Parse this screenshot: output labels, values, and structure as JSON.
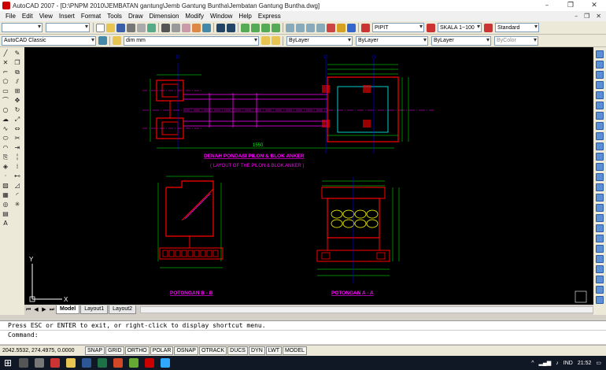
{
  "window": {
    "title": "AutoCAD 2007 - [D:\\PNPM 2010\\JEMBATAN gantung\\Jemb Gantung Buntha\\Jembatan Gantung Buntha.dwg]",
    "minimize": "–",
    "maximize": "❐",
    "close": "✕"
  },
  "menu": [
    "File",
    "Edit",
    "View",
    "Insert",
    "Format",
    "Tools",
    "Draw",
    "Dimension",
    "Modify",
    "Window",
    "Help",
    "Express"
  ],
  "toolbar": {
    "text_style": "PIPIT",
    "dim_style": "SKALA 1~100",
    "table_style": "Standard",
    "workspace": "AutoCAD Classic",
    "layer": "dim mm",
    "color": "ByLayer",
    "linetype": "ByLayer",
    "lineweight": "ByLayer",
    "plotstyle": "ByColor"
  },
  "tabs": [
    "Model",
    "Layout1",
    "Layout2"
  ],
  "command": {
    "history": "Press ESC or ENTER to exit, or right-click to display shortcut menu.",
    "prompt": "Command:"
  },
  "status": {
    "coords": "2042.5532, 274.4975, 0.0000",
    "buttons": [
      "SNAP",
      "GRID",
      "ORTHO",
      "POLAR",
      "OSNAP",
      "OTRACK",
      "DUCS",
      "DYN",
      "LWT",
      "MODEL"
    ]
  },
  "drawing": {
    "plan_title": "DENAH PONDASI PILON & BLOK ANKER",
    "plan_subtitle": "( LAYOUT OF THE PILON & BLOK ANKER )",
    "section_b": "POTONGAN B - B",
    "section_a": "POTONGAN A - A",
    "dim_total": "1550",
    "ucs_x": "X",
    "ucs_y": "Y"
  },
  "taskbar": {
    "lang": "IND",
    "time": "21:52"
  },
  "colors": {
    "canvas": "#000000",
    "red": "#ff0000",
    "cyan": "#00ffff",
    "green": "#00ff00",
    "magenta": "#ff00ff",
    "blue": "#0000ff",
    "yellow": "#ffff00"
  }
}
